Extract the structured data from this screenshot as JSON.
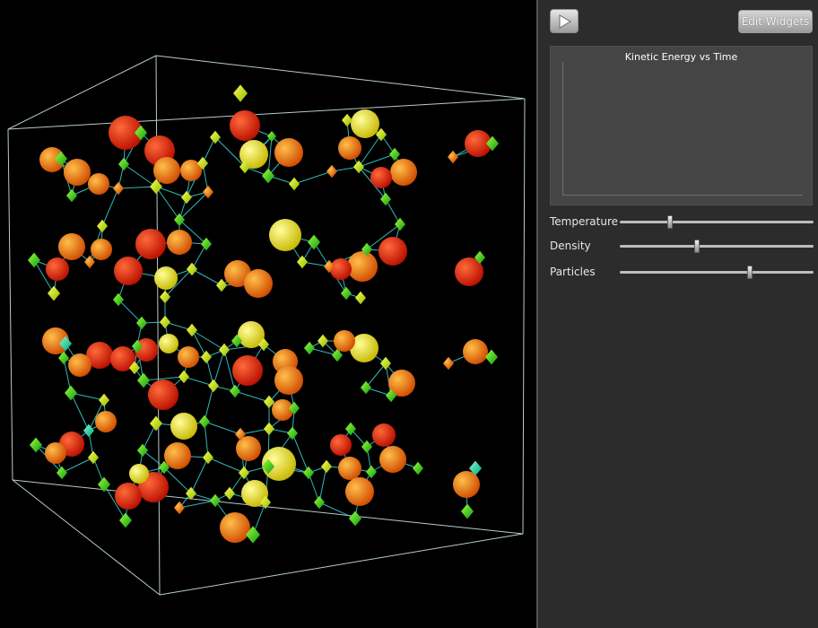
{
  "toolbar": {
    "play_icon": "play-icon",
    "edit_widgets_label": "Edit Widgets"
  },
  "chart": {
    "title": "Kinetic Energy vs Time"
  },
  "sliders": [
    {
      "label": "Temperature",
      "value": 0.26
    },
    {
      "label": "Density",
      "value": 0.4
    },
    {
      "label": "Particles",
      "value": 0.67
    }
  ],
  "colors": {
    "panel_bg": "#2c2c2c",
    "chart_bg": "#454545",
    "bond": "#3ee8e8",
    "box_edge": "#d8f0f0"
  }
}
